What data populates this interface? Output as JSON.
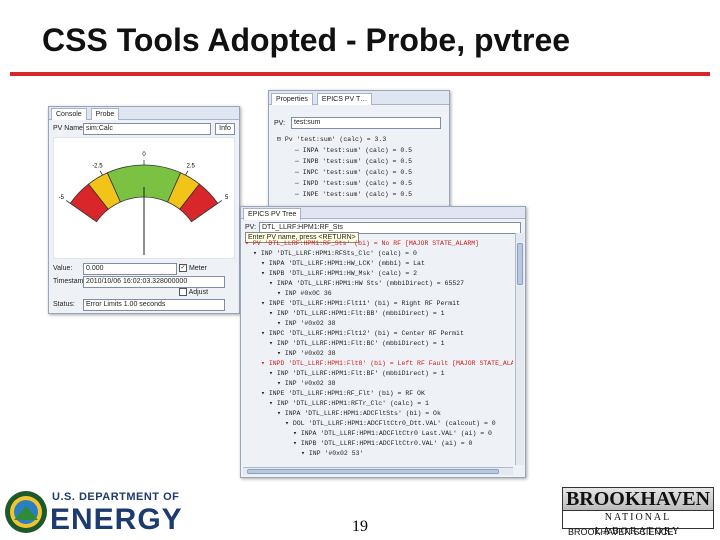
{
  "slide": {
    "title": "CSS Tools Adopted - Probe, pvtree",
    "page_number": "19"
  },
  "probe": {
    "tabs": [
      "Console",
      "Probe"
    ],
    "pv_label": "PV Name:",
    "pv_value": "sim:Calc",
    "info_button": "Info",
    "meter_ticks": [
      "-5",
      "-2.5",
      "0",
      "2.5",
      "5"
    ],
    "value_label": "Value:",
    "value": "0.000",
    "meter_check": "Meter",
    "timestamp_label": "Timestamp:",
    "timestamp": "2010/10/06 16:02:03.328000000",
    "adjust_check": "Adjust",
    "status_label": "Status:",
    "status": "Error Limits 1.00 seconds"
  },
  "properties": {
    "tabs": [
      "Properties",
      "EPICS PV T…"
    ],
    "pv_label": "PV:",
    "pv_value": "test:sum",
    "lines": [
      "Pv 'test:sum' (calc) = 3.3",
      "INPA 'test:sum' (calc) = 0.5",
      "INPB 'test:sum' (calc) = 0.5",
      "INPC 'test:sum' (calc) = 0.5",
      "INPD 'test:sum' (calc) = 0.5",
      "INPE 'test:sum' (calc) = 0.5"
    ]
  },
  "pvtree": {
    "tab": "EPICS PV Tree",
    "pv_label": "PV:",
    "pv_value": "DTL_LLRF:HPM1:RF_Sts",
    "hint": "Enter PV name, press <RETURN>",
    "lines": [
      {
        "indent": 0,
        "text": "PV 'DTL_LLRF:HPM1:RF_Sts' (bi) = No RF [MAJOR STATE_ALARM]",
        "alarm": true
      },
      {
        "indent": 1,
        "text": "INP 'DTL_LLRF:HPM1:RFSts_Clc' (calc) = 0",
        "alarm": false
      },
      {
        "indent": 2,
        "text": "INPA 'DTL_LLRF:HPM1:HW_LCK' (mbbi) = Lat",
        "alarm": false
      },
      {
        "indent": 2,
        "text": "INPB 'DTL_LLRF:HPM1:HW_Msk' (calc) = 2",
        "alarm": false
      },
      {
        "indent": 3,
        "text": "INPA 'DTL_LLRF:HPM1:HW Sts' (mbbiDirect) = 65527",
        "alarm": false
      },
      {
        "indent": 4,
        "text": "INP #0x0C 36",
        "alarm": false
      },
      {
        "indent": 2,
        "text": "INPE 'DTL_LLRF:HPM1:Flt11' (bi) = Right RF Permit",
        "alarm": false
      },
      {
        "indent": 3,
        "text": "INP 'DTL_LLRF:HPM1:Flt:BB' (mbbiDirect) = 1",
        "alarm": false
      },
      {
        "indent": 4,
        "text": "INP '#0x02 38",
        "alarm": false
      },
      {
        "indent": 2,
        "text": "INPC 'DTL_LLRF:HPM1:Flt12' (bi) = Center RF Permit",
        "alarm": false
      },
      {
        "indent": 3,
        "text": "INP 'DTL_LLRF:HPM1:Flt:BC' (mbbiDirect) = 1",
        "alarm": false
      },
      {
        "indent": 4,
        "text": "INP '#0x02 38",
        "alarm": false
      },
      {
        "indent": 2,
        "text": "INPD 'DTL_LLRF:HPM1:Flt8' (bi) = Left RF Fault [MAJOR STATE_ALARM]",
        "alarm": true
      },
      {
        "indent": 3,
        "text": "INP 'DTL_LLRF:HPM1:Flt:BF' (mbbiDirect) = 1",
        "alarm": false
      },
      {
        "indent": 4,
        "text": "INP '#0x02 38",
        "alarm": false
      },
      {
        "indent": 2,
        "text": "INPE 'DTL_LLRF:HPM1:RF_Flt' (bi) = RF OK",
        "alarm": false
      },
      {
        "indent": 3,
        "text": "INP 'DTL_LLRF:HPM1:RFTr_Clc' (calc) = 1",
        "alarm": false
      },
      {
        "indent": 4,
        "text": "INPA 'DTL_LLRF:HPM1:ADCFltSts' (bi) = Ok",
        "alarm": false
      },
      {
        "indent": 5,
        "text": "DOL 'DTL_LLRF:HPM1:ADCFltCtr0_Dtt.VAL' (calcout) = 0",
        "alarm": false
      },
      {
        "indent": 6,
        "text": "INPA 'DTL_LLRF:HPM1:ADCFltCtr0 Last.VAL' (ai) = 0",
        "alarm": false
      },
      {
        "indent": 6,
        "text": "INPB 'DTL_LLRF:HPM1:ADCFltCtr0.VAL' (ai) = 0",
        "alarm": false
      },
      {
        "indent": 7,
        "text": "INP '#0x02 53'",
        "alarm": false
      }
    ]
  },
  "logos": {
    "doe_line1": "U.S. DEPARTMENT OF",
    "doe_line2": "ENERGY",
    "bnl_top": "BROOKHAVEN",
    "bnl_bottom": "NATIONAL LABORATORY",
    "bnl_caption": "BROOKHAVEN SCIENCE"
  }
}
